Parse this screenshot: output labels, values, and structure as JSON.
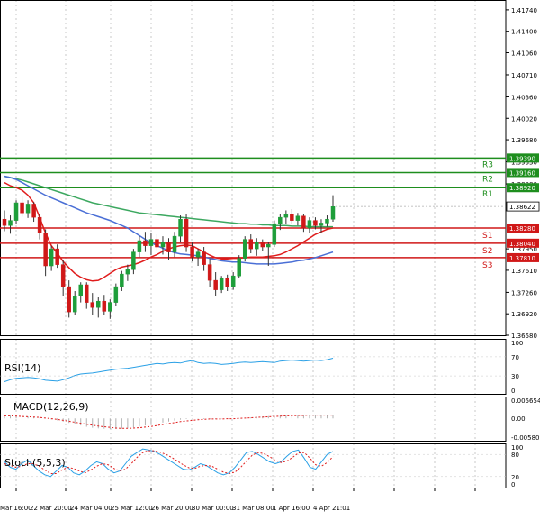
{
  "colors": {
    "background": "#ffffff",
    "grid": "#c8c8c8",
    "frame": "#000000",
    "candle_up": "#1e9e3a",
    "candle_down": "#d01818",
    "resistance": "#1e8e1e",
    "support": "#d01818",
    "ma_fast": "#e01c1c",
    "ma_mid": "#4a6fd6",
    "ma_slow": "#3ca860",
    "price_tag": "#ffffff",
    "rsi": "#2aa0e6",
    "macd_hist": "#b0b0b0",
    "macd_signal": "#e01c1c",
    "stoch_main": "#2aa0e6",
    "stoch_signal": "#e01c1c"
  },
  "chart_data": [
    {
      "type": "candlestick",
      "title": "",
      "xlabel": "",
      "ylabel": "",
      "ylim": [
        1.3658,
        1.4181
      ],
      "x_ticks": [
        "Mar 16:00",
        "22 Mar 20:00",
        "24 Mar 04:00",
        "25 Mar 12:00",
        "26 Mar 20:00",
        "30 Mar 00:00",
        "31 Mar 08:00",
        "1 Apr 16:00",
        "4 Apr 21:01"
      ],
      "y_ticks": [
        "1.41740",
        "1.41400",
        "1.41060",
        "1.40710",
        "1.40360",
        "1.40020",
        "1.39680",
        "1.39330",
        "1.38980",
        "1.37950",
        "1.37610",
        "1.37260",
        "1.36920",
        "1.36580"
      ],
      "current_price": "1.38622",
      "levels": [
        {
          "label": "R3",
          "value": 1.3939,
          "tag": "1.39390",
          "kind": "resistance"
        },
        {
          "label": "R2",
          "value": 1.3916,
          "tag": "1.39160",
          "kind": "resistance"
        },
        {
          "label": "R1",
          "value": 1.3892,
          "tag": "1.38920",
          "kind": "resistance"
        },
        {
          "label": "S1",
          "value": 1.3828,
          "tag": "1.38280",
          "kind": "support"
        },
        {
          "label": "S2",
          "value": 1.3804,
          "tag": "1.38040",
          "kind": "support"
        },
        {
          "label": "S3",
          "value": 1.3781,
          "tag": "1.37810",
          "kind": "support"
        }
      ],
      "candles": [
        {
          "o": 1.3842,
          "h": 1.3856,
          "l": 1.3823,
          "c": 1.3832
        },
        {
          "o": 1.3832,
          "h": 1.3848,
          "l": 1.3819,
          "c": 1.384
        },
        {
          "o": 1.384,
          "h": 1.3872,
          "l": 1.3835,
          "c": 1.3868
        },
        {
          "o": 1.3868,
          "h": 1.3879,
          "l": 1.3846,
          "c": 1.3852
        },
        {
          "o": 1.3852,
          "h": 1.3872,
          "l": 1.3844,
          "c": 1.3866
        },
        {
          "o": 1.3866,
          "h": 1.3869,
          "l": 1.3838,
          "c": 1.3845
        },
        {
          "o": 1.3845,
          "h": 1.3851,
          "l": 1.381,
          "c": 1.382
        },
        {
          "o": 1.382,
          "h": 1.3826,
          "l": 1.3752,
          "c": 1.3768
        },
        {
          "o": 1.3768,
          "h": 1.38,
          "l": 1.376,
          "c": 1.3795
        },
        {
          "o": 1.3795,
          "h": 1.3802,
          "l": 1.3765,
          "c": 1.377
        },
        {
          "o": 1.377,
          "h": 1.3778,
          "l": 1.372,
          "c": 1.3735
        },
        {
          "o": 1.3735,
          "h": 1.3745,
          "l": 1.3686,
          "c": 1.3695
        },
        {
          "o": 1.3695,
          "h": 1.3728,
          "l": 1.369,
          "c": 1.372
        },
        {
          "o": 1.372,
          "h": 1.3742,
          "l": 1.371,
          "c": 1.3738
        },
        {
          "o": 1.3738,
          "h": 1.3742,
          "l": 1.37,
          "c": 1.371
        },
        {
          "o": 1.371,
          "h": 1.3725,
          "l": 1.369,
          "c": 1.3702
        },
        {
          "o": 1.3702,
          "h": 1.3718,
          "l": 1.3686,
          "c": 1.3712
        },
        {
          "o": 1.3712,
          "h": 1.3722,
          "l": 1.369,
          "c": 1.3696
        },
        {
          "o": 1.3696,
          "h": 1.3715,
          "l": 1.3684,
          "c": 1.371
        },
        {
          "o": 1.371,
          "h": 1.374,
          "l": 1.3704,
          "c": 1.3735
        },
        {
          "o": 1.3735,
          "h": 1.376,
          "l": 1.3728,
          "c": 1.3755
        },
        {
          "o": 1.3755,
          "h": 1.377,
          "l": 1.3744,
          "c": 1.3762
        },
        {
          "o": 1.3762,
          "h": 1.3795,
          "l": 1.3755,
          "c": 1.379
        },
        {
          "o": 1.379,
          "h": 1.3815,
          "l": 1.3782,
          "c": 1.3808
        },
        {
          "o": 1.3808,
          "h": 1.3822,
          "l": 1.379,
          "c": 1.38
        },
        {
          "o": 1.38,
          "h": 1.382,
          "l": 1.3785,
          "c": 1.381
        },
        {
          "o": 1.381,
          "h": 1.3818,
          "l": 1.3792,
          "c": 1.3798
        },
        {
          "o": 1.3798,
          "h": 1.3815,
          "l": 1.3786,
          "c": 1.3806
        },
        {
          "o": 1.3806,
          "h": 1.3812,
          "l": 1.3778,
          "c": 1.379
        },
        {
          "o": 1.379,
          "h": 1.3822,
          "l": 1.3782,
          "c": 1.3815
        },
        {
          "o": 1.3815,
          "h": 1.3848,
          "l": 1.3805,
          "c": 1.3842
        },
        {
          "o": 1.3842,
          "h": 1.385,
          "l": 1.379,
          "c": 1.3798
        },
        {
          "o": 1.3798,
          "h": 1.3805,
          "l": 1.3775,
          "c": 1.3782
        },
        {
          "o": 1.3782,
          "h": 1.3795,
          "l": 1.3768,
          "c": 1.379
        },
        {
          "o": 1.379,
          "h": 1.3798,
          "l": 1.376,
          "c": 1.377
        },
        {
          "o": 1.377,
          "h": 1.378,
          "l": 1.3735,
          "c": 1.3745
        },
        {
          "o": 1.3745,
          "h": 1.3758,
          "l": 1.372,
          "c": 1.373
        },
        {
          "o": 1.373,
          "h": 1.3752,
          "l": 1.3725,
          "c": 1.3748
        },
        {
          "o": 1.3748,
          "h": 1.3754,
          "l": 1.3728,
          "c": 1.3735
        },
        {
          "o": 1.3735,
          "h": 1.3758,
          "l": 1.373,
          "c": 1.3752
        },
        {
          "o": 1.3752,
          "h": 1.3785,
          "l": 1.3748,
          "c": 1.378
        },
        {
          "o": 1.378,
          "h": 1.3815,
          "l": 1.3775,
          "c": 1.381
        },
        {
          "o": 1.381,
          "h": 1.3818,
          "l": 1.3788,
          "c": 1.3795
        },
        {
          "o": 1.3795,
          "h": 1.3812,
          "l": 1.3784,
          "c": 1.3805
        },
        {
          "o": 1.3805,
          "h": 1.381,
          "l": 1.3792,
          "c": 1.3798
        },
        {
          "o": 1.3798,
          "h": 1.3806,
          "l": 1.3768,
          "c": 1.3802
        },
        {
          "o": 1.3802,
          "h": 1.384,
          "l": 1.3798,
          "c": 1.3835
        },
        {
          "o": 1.3835,
          "h": 1.385,
          "l": 1.3825,
          "c": 1.3845
        },
        {
          "o": 1.3845,
          "h": 1.3856,
          "l": 1.3835,
          "c": 1.385
        },
        {
          "o": 1.385,
          "h": 1.3858,
          "l": 1.3835,
          "c": 1.384
        },
        {
          "o": 1.384,
          "h": 1.3852,
          "l": 1.3832,
          "c": 1.3847
        },
        {
          "o": 1.3847,
          "h": 1.385,
          "l": 1.3822,
          "c": 1.3828
        },
        {
          "o": 1.3828,
          "h": 1.3845,
          "l": 1.382,
          "c": 1.384
        },
        {
          "o": 1.384,
          "h": 1.3845,
          "l": 1.3826,
          "c": 1.3832
        },
        {
          "o": 1.3832,
          "h": 1.3842,
          "l": 1.382,
          "c": 1.3836
        },
        {
          "o": 1.3836,
          "h": 1.3848,
          "l": 1.383,
          "c": 1.3842
        },
        {
          "o": 1.3842,
          "h": 1.388,
          "l": 1.3838,
          "c": 1.3862
        }
      ],
      "ma_fast": [
        1.39,
        1.3895,
        1.3892,
        1.3888,
        1.388,
        1.3868,
        1.3845,
        1.382,
        1.38,
        1.3788,
        1.3775,
        1.3765,
        1.3756,
        1.375,
        1.3746,
        1.3744,
        1.3745,
        1.375,
        1.3756,
        1.3762,
        1.3766,
        1.3768,
        1.377,
        1.3773,
        1.3777,
        1.3782,
        1.3786,
        1.3791,
        1.3795,
        1.3798,
        1.38,
        1.3801,
        1.38,
        1.3795,
        1.379,
        1.3785,
        1.3781,
        1.3779,
        1.3779,
        1.378,
        1.378,
        1.3781,
        1.3782,
        1.3782,
        1.3782,
        1.3783,
        1.3784,
        1.3786,
        1.379,
        1.3795,
        1.38,
        1.3806,
        1.3812,
        1.3818,
        1.3822,
        1.3826,
        1.3828
      ],
      "ma_mid": [
        1.391,
        1.3908,
        1.3905,
        1.39,
        1.3895,
        1.389,
        1.3885,
        1.388,
        1.3876,
        1.3872,
        1.3868,
        1.3864,
        1.386,
        1.3856,
        1.3852,
        1.3849,
        1.3846,
        1.3843,
        1.384,
        1.3836,
        1.3832,
        1.3828,
        1.3822,
        1.3816,
        1.381,
        1.3805,
        1.38,
        1.3796,
        1.3792,
        1.3789,
        1.3787,
        1.3786,
        1.3785,
        1.3784,
        1.3782,
        1.378,
        1.3778,
        1.3776,
        1.3775,
        1.3774,
        1.3774,
        1.3773,
        1.3772,
        1.3771,
        1.3771,
        1.3771,
        1.3771,
        1.3772,
        1.3773,
        1.3774,
        1.3776,
        1.3777,
        1.3779,
        1.3781,
        1.3784,
        1.3787,
        1.379
      ],
      "ma_slow": [
        1.391,
        1.3908,
        1.3906,
        1.3904,
        1.3901,
        1.3898,
        1.3895,
        1.3892,
        1.3889,
        1.3886,
        1.3883,
        1.388,
        1.3877,
        1.3874,
        1.3871,
        1.3868,
        1.3866,
        1.3864,
        1.3862,
        1.386,
        1.3858,
        1.3856,
        1.3854,
        1.3852,
        1.3851,
        1.385,
        1.3849,
        1.3848,
        1.3847,
        1.3846,
        1.3845,
        1.3844,
        1.3843,
        1.3842,
        1.3841,
        1.384,
        1.3839,
        1.3838,
        1.3837,
        1.3836,
        1.3835,
        1.3835,
        1.3834,
        1.3834,
        1.3833,
        1.3833,
        1.3832,
        1.3832,
        1.3832,
        1.3831,
        1.3831,
        1.3831,
        1.383,
        1.383,
        1.383,
        1.383,
        1.383
      ]
    },
    {
      "type": "line",
      "title": "RSI(14)",
      "ylim": [
        0,
        100
      ],
      "y_ticks": [
        "100",
        "70",
        "30",
        "0"
      ],
      "series": [
        {
          "values": [
            18,
            22,
            25,
            26,
            27,
            26,
            24,
            21,
            20,
            19,
            22,
            26,
            31,
            34,
            35,
            36,
            38,
            40,
            42,
            44,
            45,
            46,
            48,
            50,
            52,
            54,
            56,
            55,
            57,
            58,
            57,
            60,
            62,
            58,
            56,
            57,
            56,
            54,
            55,
            56,
            58,
            59,
            58,
            59,
            60,
            59,
            58,
            61,
            62,
            63,
            62,
            61,
            62,
            63,
            62,
            64,
            67
          ]
        }
      ]
    },
    {
      "type": "bar",
      "title": "MACD(12,26,9)",
      "ylim": [
        -0.005809,
        0.005654
      ],
      "y_ticks": [
        "0.005654",
        "0.00",
        "-0.005809"
      ],
      "series": [
        {
          "name": "histogram",
          "values": [
            0.001,
            0.0009,
            0.0008,
            0.0007,
            0.0006,
            0.0004,
            0.0002,
            0.0,
            -0.0003,
            -0.0006,
            -0.001,
            -0.0014,
            -0.0018,
            -0.0022,
            -0.0026,
            -0.0029,
            -0.0031,
            -0.0032,
            -0.0033,
            -0.0033,
            -0.0032,
            -0.003,
            -0.0028,
            -0.0025,
            -0.0022,
            -0.0019,
            -0.0016,
            -0.0013,
            -0.001,
            -0.0007,
            -0.0004,
            -0.0002,
            -0.0001,
            -0.0001,
            -0.0002,
            -0.0002,
            -0.0002,
            -0.0001,
            -0.0001,
            0.0,
            0.0001,
            0.0002,
            0.0003,
            0.0005,
            0.0006,
            0.0007,
            0.0008,
            0.0009,
            0.0009,
            0.001,
            0.001,
            0.0011,
            0.0011,
            0.0011,
            0.0011,
            0.0011,
            0.0011
          ]
        },
        {
          "name": "signal",
          "values": [
            0.0008,
            0.0008,
            0.0007,
            0.0006,
            0.0005,
            0.0004,
            0.0003,
            0.0001,
            -0.0001,
            -0.0003,
            -0.0006,
            -0.0009,
            -0.0012,
            -0.0015,
            -0.0018,
            -0.0021,
            -0.0024,
            -0.0026,
            -0.0028,
            -0.003,
            -0.0031,
            -0.0031,
            -0.003,
            -0.0029,
            -0.0027,
            -0.0025,
            -0.0022,
            -0.0019,
            -0.0016,
            -0.0013,
            -0.001,
            -0.0008,
            -0.0006,
            -0.0004,
            -0.0003,
            -0.0002,
            -0.0002,
            -0.0002,
            -0.0001,
            -0.0001,
            0.0,
            0.0001,
            0.0002,
            0.0003,
            0.0004,
            0.0005,
            0.0006,
            0.0007,
            0.0008,
            0.0008,
            0.0009,
            0.0009,
            0.001,
            0.001,
            0.001,
            0.001,
            0.001
          ]
        }
      ]
    },
    {
      "type": "line",
      "title": "Stoch(5,5,3)",
      "ylim": [
        0,
        100
      ],
      "y_ticks": [
        "100",
        "80",
        "20",
        "0"
      ],
      "series": [
        {
          "name": "main",
          "values": [
            60,
            45,
            40,
            55,
            65,
            50,
            35,
            25,
            20,
            35,
            50,
            45,
            30,
            25,
            35,
            50,
            60,
            55,
            40,
            30,
            35,
            55,
            75,
            85,
            95,
            92,
            88,
            80,
            70,
            60,
            50,
            40,
            38,
            45,
            55,
            50,
            40,
            30,
            25,
            30,
            45,
            65,
            85,
            88,
            80,
            70,
            60,
            55,
            60,
            75,
            88,
            92,
            70,
            45,
            40,
            60,
            80,
            88
          ]
        },
        {
          "name": "signal",
          "values": [
            55,
            50,
            45,
            48,
            55,
            55,
            48,
            38,
            28,
            28,
            38,
            45,
            42,
            35,
            30,
            38,
            48,
            55,
            52,
            42,
            35,
            40,
            55,
            72,
            85,
            90,
            90,
            86,
            80,
            72,
            62,
            52,
            44,
            42,
            48,
            50,
            48,
            40,
            32,
            28,
            32,
            45,
            62,
            78,
            85,
            82,
            74,
            64,
            58,
            62,
            72,
            84,
            85,
            70,
            52,
            48,
            58,
            74
          ]
        }
      ]
    }
  ]
}
